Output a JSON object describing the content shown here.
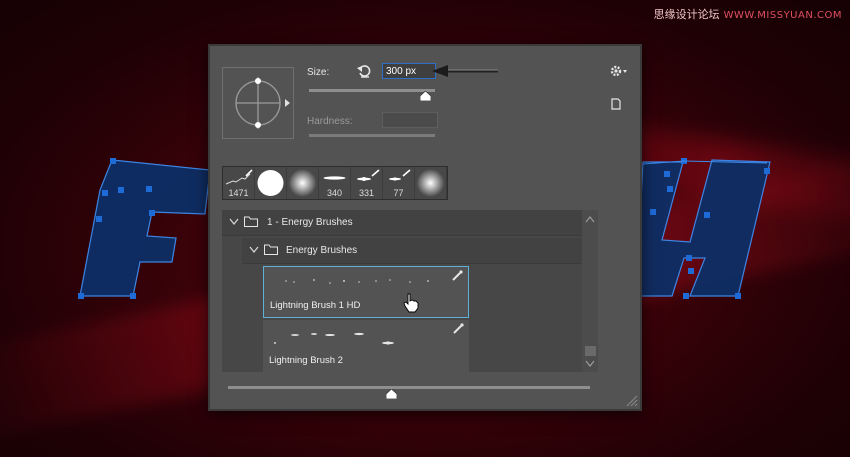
{
  "watermark": {
    "text": "思缘设计论坛",
    "site": "WWW.MISSYUAN.COM"
  },
  "background": {
    "accent": "#1e6bd8",
    "fill": "#0e3a7a"
  },
  "brush_panel": {
    "size_label": "Size:",
    "size_value": "300 px",
    "hardness_label": "Hardness:",
    "settings_icon": "gear-icon",
    "new_preset_icon": "new-preset-icon",
    "recent_brushes": [
      {
        "count": "1471",
        "kind": "lightning-scribble"
      },
      {
        "count": "",
        "kind": "hard-round"
      },
      {
        "count": "",
        "kind": "soft-round"
      },
      {
        "count": "340",
        "kind": "flare"
      },
      {
        "count": "331",
        "kind": "sparkle"
      },
      {
        "count": "77",
        "kind": "sparkle-small"
      },
      {
        "count": "",
        "kind": "soft-round-large"
      }
    ],
    "folders": [
      {
        "label": "1 - Energy Brushes"
      },
      {
        "label": "Energy Brushes"
      }
    ],
    "brushes": [
      {
        "label": "Lightning Brush 1 HD",
        "selected": true
      },
      {
        "label": "Lightning Brush 2",
        "selected": false
      }
    ]
  }
}
